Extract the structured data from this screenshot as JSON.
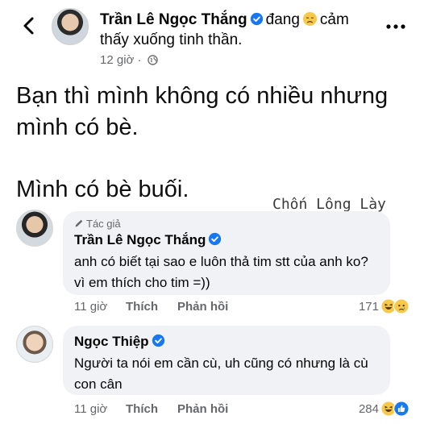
{
  "header": {
    "author": "Trần Lê Ngọc Thắng",
    "feeling_prefix": "đang",
    "feeling_text": "cảm thấy xuống tinh thần.",
    "time": "12 giờ ·"
  },
  "post": {
    "paragraphs": [
      "Bạn thì mình không có nhiều nhưng mình có bè.",
      "Mình có bè buối."
    ]
  },
  "watermark": "Chốn Lông Lày",
  "comments": [
    {
      "badge": "Tác giả",
      "author": "Trần Lê Ngọc Thắng",
      "text": "anh có biết tại sao e luôn thả tim stt của anh ko? vì em thích  cho tim =))",
      "time": "11 giờ",
      "like": "Thích",
      "reply": "Phản hồi",
      "reaction_count": "171",
      "reactions": [
        "haha",
        "sad"
      ]
    },
    {
      "author": "Ngọc Thiệp",
      "text": "Người ta nói em cần cù, uh cũng có nhưng là cù con cân",
      "time": "11 giờ",
      "like": "Thích",
      "reply": "Phản hồi",
      "reaction_count": "284",
      "reactions": [
        "haha",
        "like"
      ]
    }
  ],
  "colors": {
    "verified": "#1877f2",
    "bubble": "#f0f2f5",
    "meta_text": "#65676b"
  }
}
